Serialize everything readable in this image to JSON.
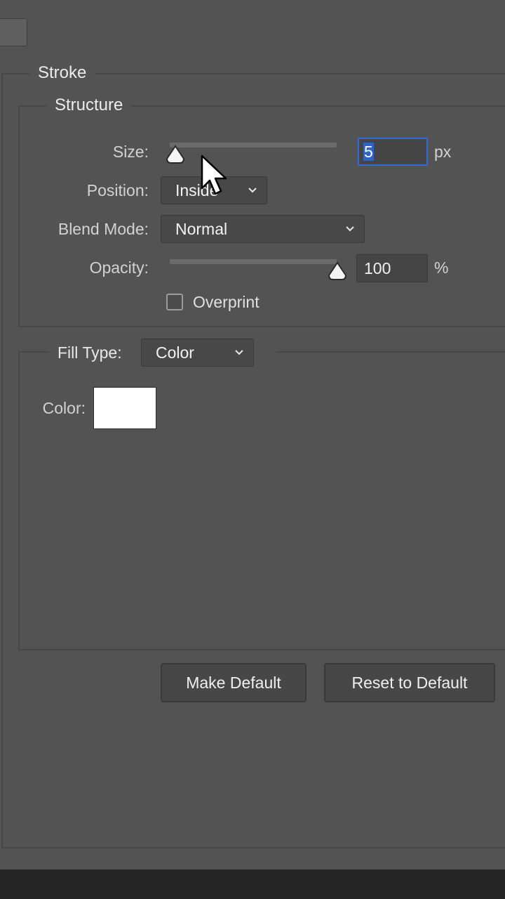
{
  "stroke": {
    "legend": "Stroke",
    "structure": {
      "legend": "Structure",
      "size": {
        "label": "Size:",
        "value": "5",
        "unit": "px",
        "slider_fraction": 0.0
      },
      "position": {
        "label": "Position:",
        "value": "Inside"
      },
      "blend_mode": {
        "label": "Blend Mode:",
        "value": "Normal"
      },
      "opacity": {
        "label": "Opacity:",
        "value": "100",
        "unit": "%",
        "slider_fraction": 1.0
      },
      "overprint": {
        "label": "Overprint",
        "checked": false
      }
    },
    "fill": {
      "fill_type_label": "Fill Type:",
      "fill_type_value": "Color",
      "color_label": "Color:",
      "color_value": "#ffffff"
    }
  },
  "buttons": {
    "make_default": "Make Default",
    "reset_to_default": "Reset to Default"
  },
  "icons": {
    "dropdown": "chevron-down-icon",
    "slider": "slider-thumb-icon",
    "pointer": "mouse-pointer-icon"
  },
  "colors": {
    "panel_bg": "#535353",
    "focus_ring": "#2e6bd6",
    "text_selection": "#2f63c8"
  }
}
